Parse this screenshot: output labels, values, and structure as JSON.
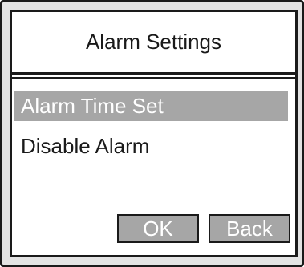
{
  "dialog": {
    "title": "Alarm Settings"
  },
  "menu": {
    "items": [
      {
        "label": "Alarm Time Set",
        "selected": true
      },
      {
        "label": "Disable Alarm",
        "selected": false
      }
    ]
  },
  "buttons": {
    "ok_label": "OK",
    "back_label": "Back"
  },
  "colors": {
    "highlight": "#a6a6a6",
    "border": "#1a1a1a",
    "frame": "#e3e3e3",
    "screen": "#ffffff"
  }
}
